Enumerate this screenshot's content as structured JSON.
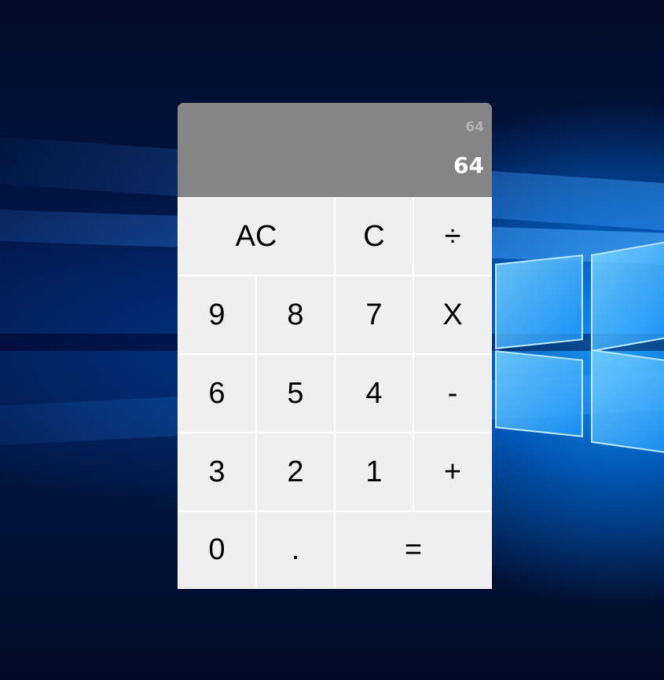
{
  "calculator": {
    "previous_operand": "64",
    "current_operand": "64",
    "keys": {
      "all_clear": "AC",
      "clear": "C",
      "divide": "÷",
      "nine": "9",
      "eight": "8",
      "seven": "7",
      "multiply": "X",
      "six": "6",
      "five": "5",
      "four": "4",
      "subtract": "-",
      "three": "3",
      "two": "2",
      "one": "1",
      "add": "+",
      "zero": "0",
      "decimal": ".",
      "equals": "="
    }
  },
  "colors": {
    "display_background": "#858585",
    "key_background": "#efefef",
    "desktop_accent": "#1e90ff"
  }
}
